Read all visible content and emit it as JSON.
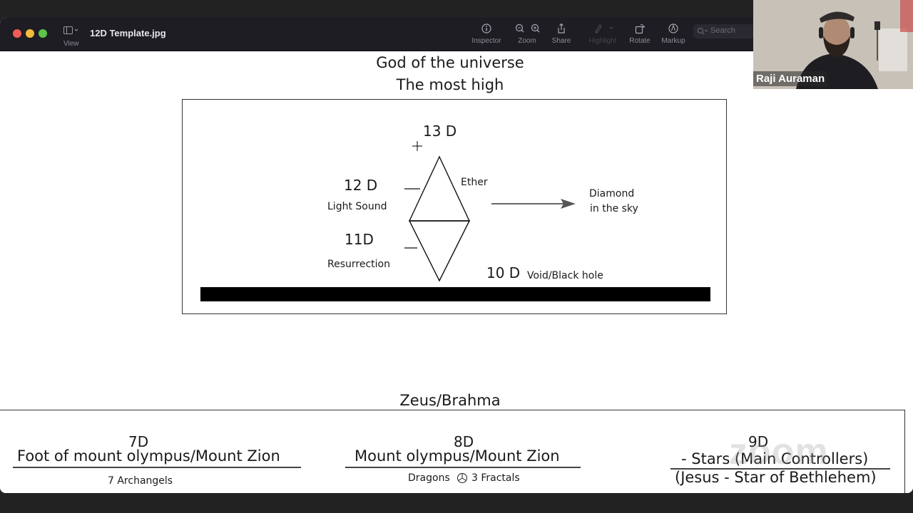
{
  "window": {
    "title": "12D Template.jpg",
    "view_label": "View",
    "toolbar": [
      {
        "id": "inspector",
        "label": "Inspector",
        "icon": "info-circle-icon",
        "enabled": true
      },
      {
        "id": "zoom",
        "label": "Zoom",
        "icon": "zoom-in-out-icon",
        "enabled": true
      },
      {
        "id": "share",
        "label": "Share",
        "icon": "share-icon",
        "enabled": true
      },
      {
        "id": "highlight",
        "label": "Highlight",
        "icon": "highlighter-icon",
        "enabled": false
      },
      {
        "id": "rotate",
        "label": "Rotate",
        "icon": "rotate-icon",
        "enabled": true
      },
      {
        "id": "markup",
        "label": "Markup",
        "icon": "markup-pen-icon",
        "enabled": true
      }
    ],
    "search_placeholder": "Search"
  },
  "diagram": {
    "heading_line1": "God of the universe",
    "heading_line2": "The most high",
    "d13": "13 D",
    "d12": "12 D",
    "d12_sub": "Light Sound",
    "d11": "11D",
    "d11_sub": "Resurrection",
    "ether": "Ether",
    "diamond_line1": "Diamond",
    "diamond_line2": "in the sky",
    "d10": "10 D",
    "d10_sub": "Void/Black hole",
    "zeus": "Zeus/Brahma",
    "d7": "7D",
    "d7_title": "Foot of mount olympus/Mount Zion",
    "d7_sub": "7 Archangels",
    "d8": "8D",
    "d8_title": "Mount olympus/Mount Zion",
    "d8_sub_left": "Dragons",
    "d8_sub_right": "3 Fractals",
    "d9": "9D",
    "d9_line1": "- Stars (Main Controllers)",
    "d9_line2": "(Jesus - Star of Bethlehem)"
  },
  "video": {
    "participant_name": "Raji Auraman",
    "watermark": "zoom"
  }
}
